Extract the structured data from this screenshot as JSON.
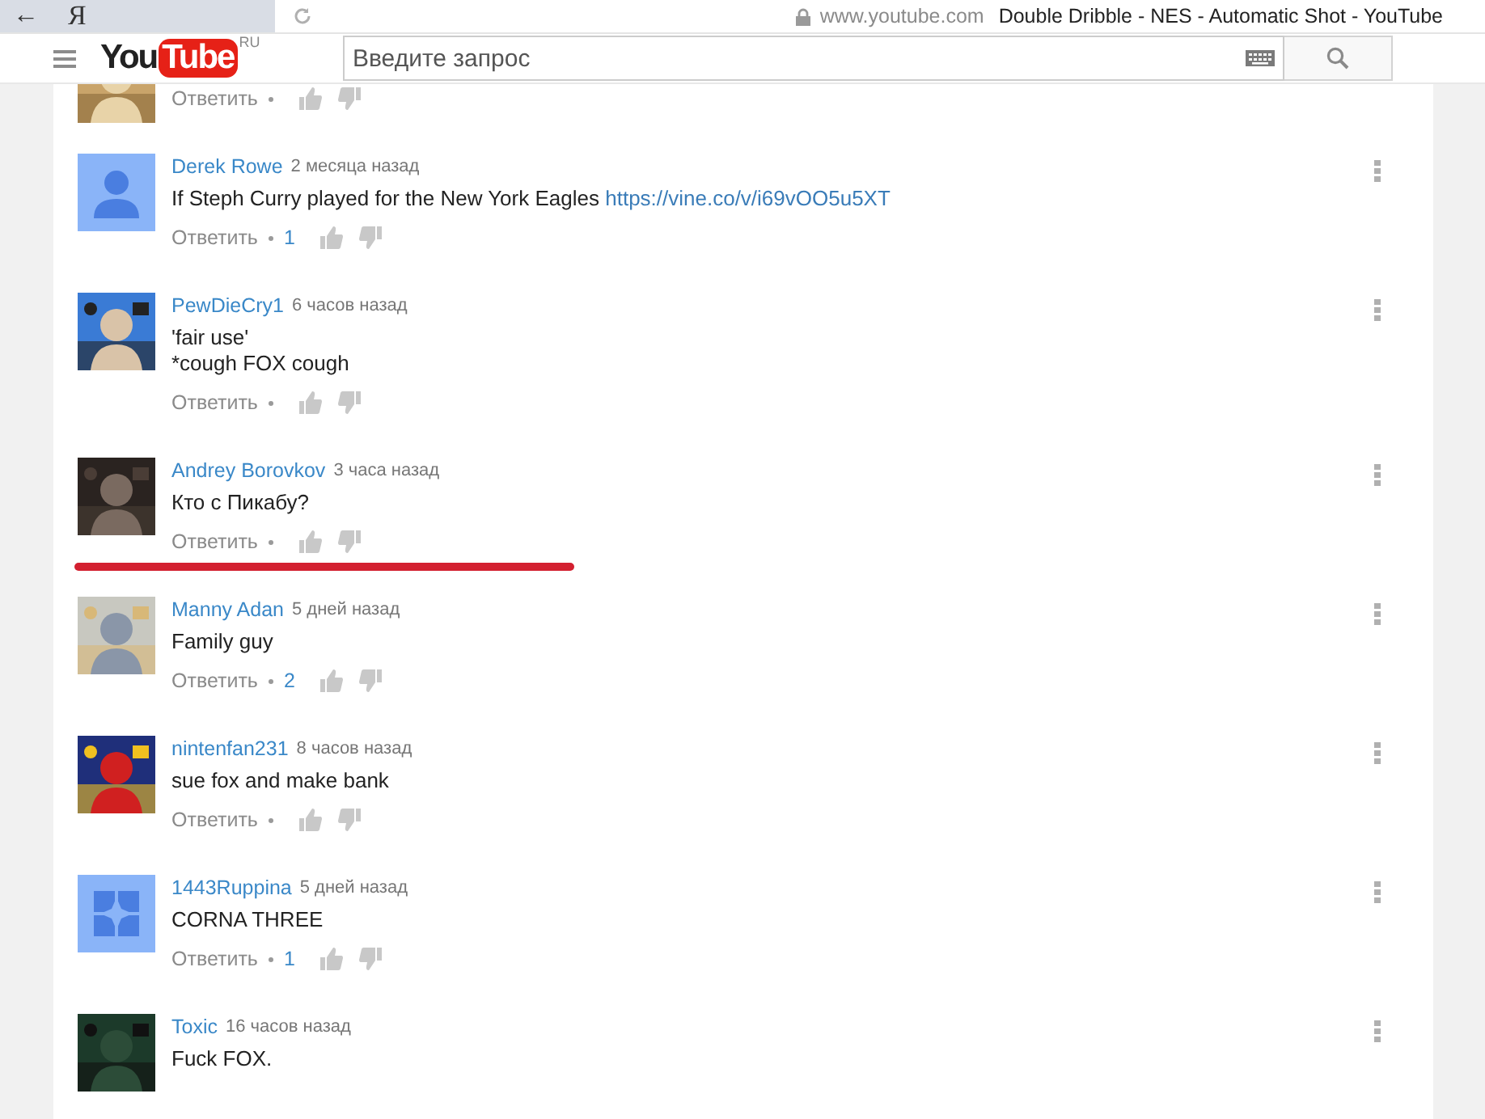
{
  "browser": {
    "back": "←",
    "home": "Я",
    "domain": "www.youtube.com",
    "title": "Double Dribble - NES - Automatic Shot - YouTube"
  },
  "header": {
    "logo_you": "You",
    "logo_tube": "Tube",
    "region": "RU",
    "search": {
      "placeholder": "Введите запрос"
    }
  },
  "comments": [
    {
      "kind": "partial",
      "avatar": {
        "kind": "picture"
      },
      "reply": "Ответить"
    },
    {
      "kind": "comment",
      "avatar": {
        "kind": "person"
      },
      "author": "Derek Rowe",
      "time": "2 месяца назад",
      "lines": [
        "If Steph Curry played for the New York Eagles"
      ],
      "link": "https://vine.co/v/i69vOO5u5XT",
      "reply": "Ответить",
      "replies": "1",
      "underlined": false
    },
    {
      "kind": "comment",
      "avatar": {
        "kind": "picture"
      },
      "author": "PewDieCry1",
      "time": "6 часов назад",
      "lines": [
        "'fair use'",
        "*cough FOX cough"
      ],
      "reply": "Ответить",
      "underlined": false
    },
    {
      "kind": "comment",
      "avatar": {
        "kind": "picture"
      },
      "author": "Andrey Borovkov",
      "time": "3 часа назад",
      "lines": [
        "Кто с Пикабу?"
      ],
      "reply": "Ответить",
      "underlined": true
    },
    {
      "kind": "comment",
      "avatar": {
        "kind": "picture"
      },
      "author": "Manny Adan",
      "time": "5 дней назад",
      "lines": [
        "Family guy"
      ],
      "reply": "Ответить",
      "replies": "2",
      "underlined": false
    },
    {
      "kind": "comment",
      "avatar": {
        "kind": "picture"
      },
      "author": "nintenfan231",
      "time": "8 часов назад",
      "lines": [
        "sue fox and make bank"
      ],
      "reply": "Ответить",
      "underlined": false
    },
    {
      "kind": "comment",
      "avatar": {
        "kind": "pattern"
      },
      "author": "1443Ruppina",
      "time": "5 дней назад",
      "lines": [
        "CORNA THREE"
      ],
      "reply": "Ответить",
      "replies": "1",
      "underlined": false
    },
    {
      "kind": "comment",
      "avatar": {
        "kind": "picture"
      },
      "author": "Toxic",
      "time": "16 часов назад",
      "lines": [
        "Fuck FOX."
      ],
      "underlined": false
    }
  ]
}
